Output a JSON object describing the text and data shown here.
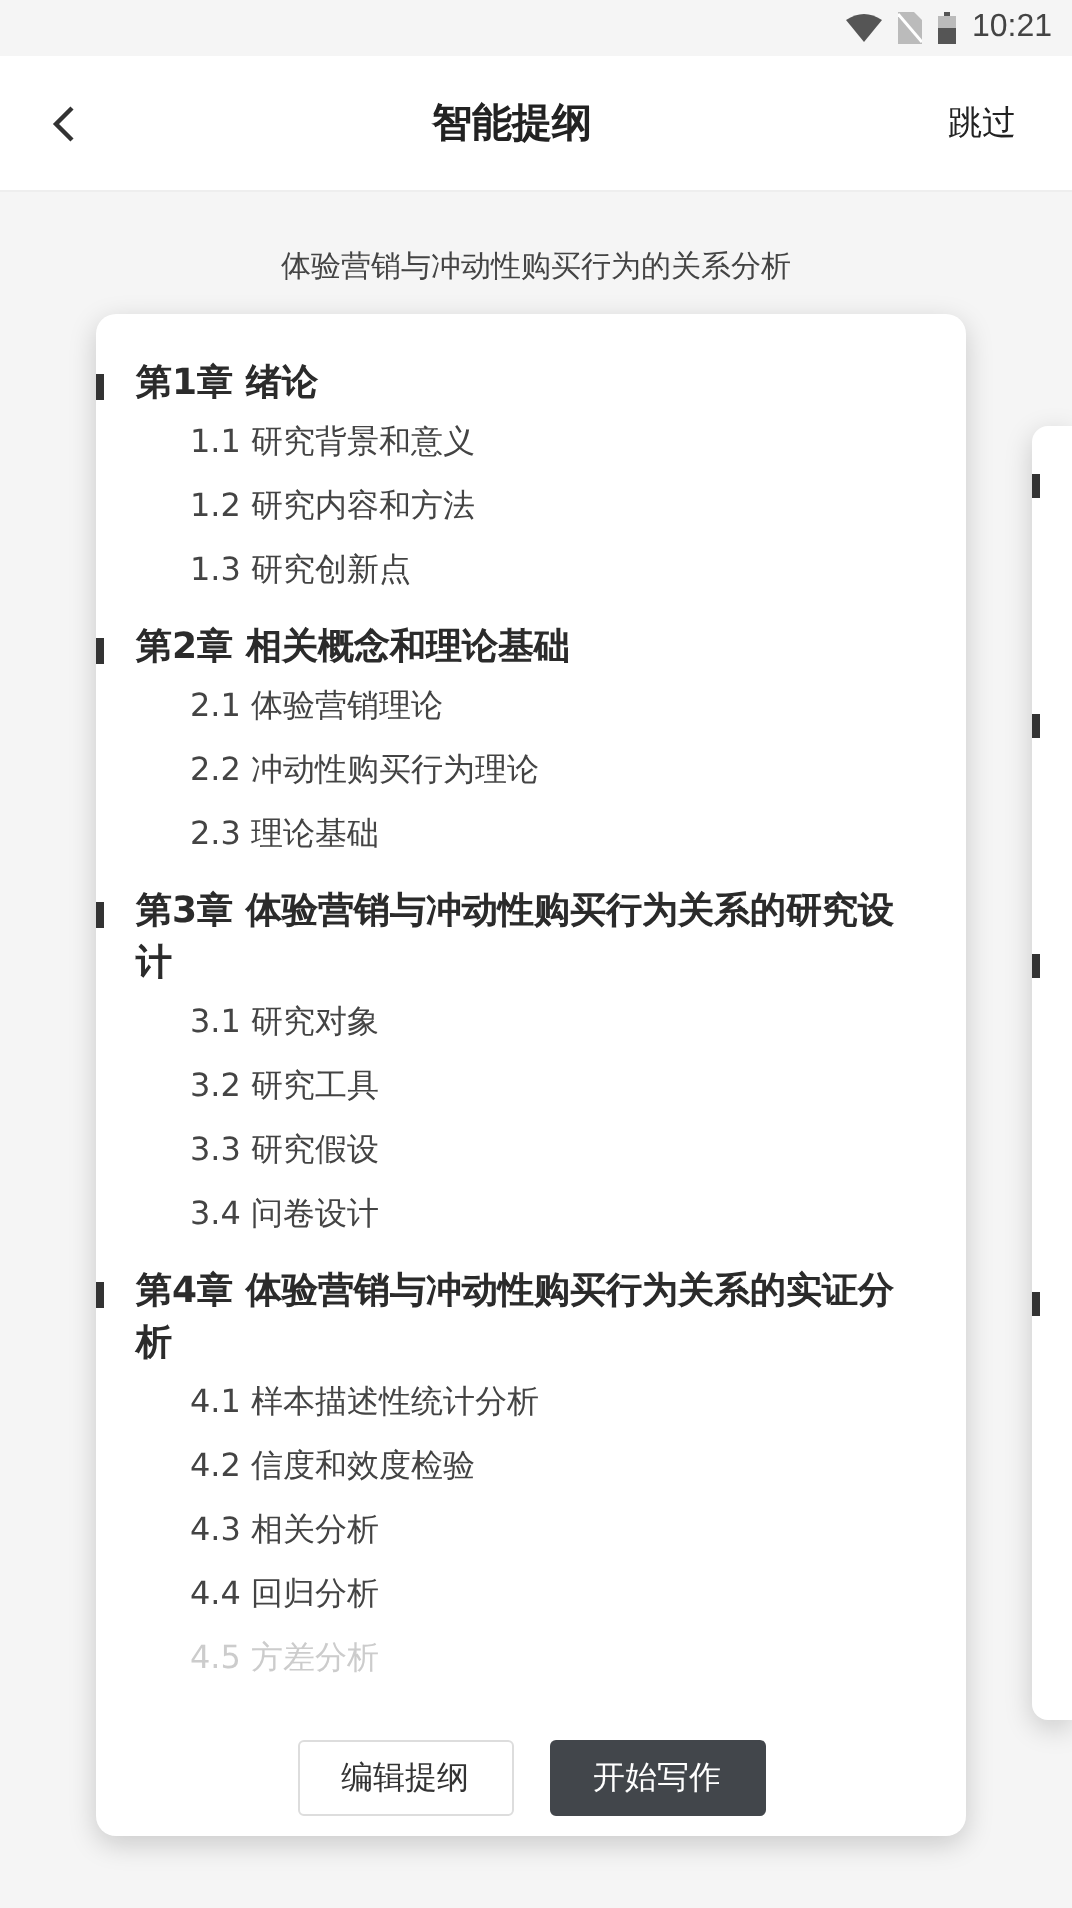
{
  "status_bar": {
    "time": "10:21"
  },
  "header": {
    "title": "智能提纲",
    "skip": "跳过"
  },
  "topic": "体验营销与冲动性购买行为的关系分析",
  "outline": [
    {
      "title": "第1章 绪论",
      "sections": [
        {
          "label": "1.1 研究背景和意义",
          "faded": false
        },
        {
          "label": "1.2 研究内容和方法",
          "faded": false
        },
        {
          "label": "1.3 研究创新点",
          "faded": false
        }
      ]
    },
    {
      "title": "第2章 相关概念和理论基础",
      "sections": [
        {
          "label": "2.1 体验营销理论",
          "faded": false
        },
        {
          "label": "2.2 冲动性购买行为理论",
          "faded": false
        },
        {
          "label": "2.3 理论基础",
          "faded": false
        }
      ]
    },
    {
      "title": "第3章 体验营销与冲动性购买行为关系的研究设计",
      "sections": [
        {
          "label": "3.1 研究对象",
          "faded": false
        },
        {
          "label": "3.2 研究工具",
          "faded": false
        },
        {
          "label": "3.3 研究假设",
          "faded": false
        },
        {
          "label": "3.4 问卷设计",
          "faded": false
        }
      ]
    },
    {
      "title": "第4章 体验营销与冲动性购买行为关系的实证分析",
      "sections": [
        {
          "label": "4.1 样本描述性统计分析",
          "faded": false
        },
        {
          "label": "4.2 信度和效度检验",
          "faded": false
        },
        {
          "label": "4.3 相关分析",
          "faded": false
        },
        {
          "label": "4.4 回归分析",
          "faded": false
        },
        {
          "label": "4.5 方差分析",
          "faded": true
        }
      ]
    }
  ],
  "buttons": [
    {
      "label": "编辑提纲",
      "kind": "secondary"
    },
    {
      "label": "开始写作",
      "kind": "primary"
    }
  ]
}
